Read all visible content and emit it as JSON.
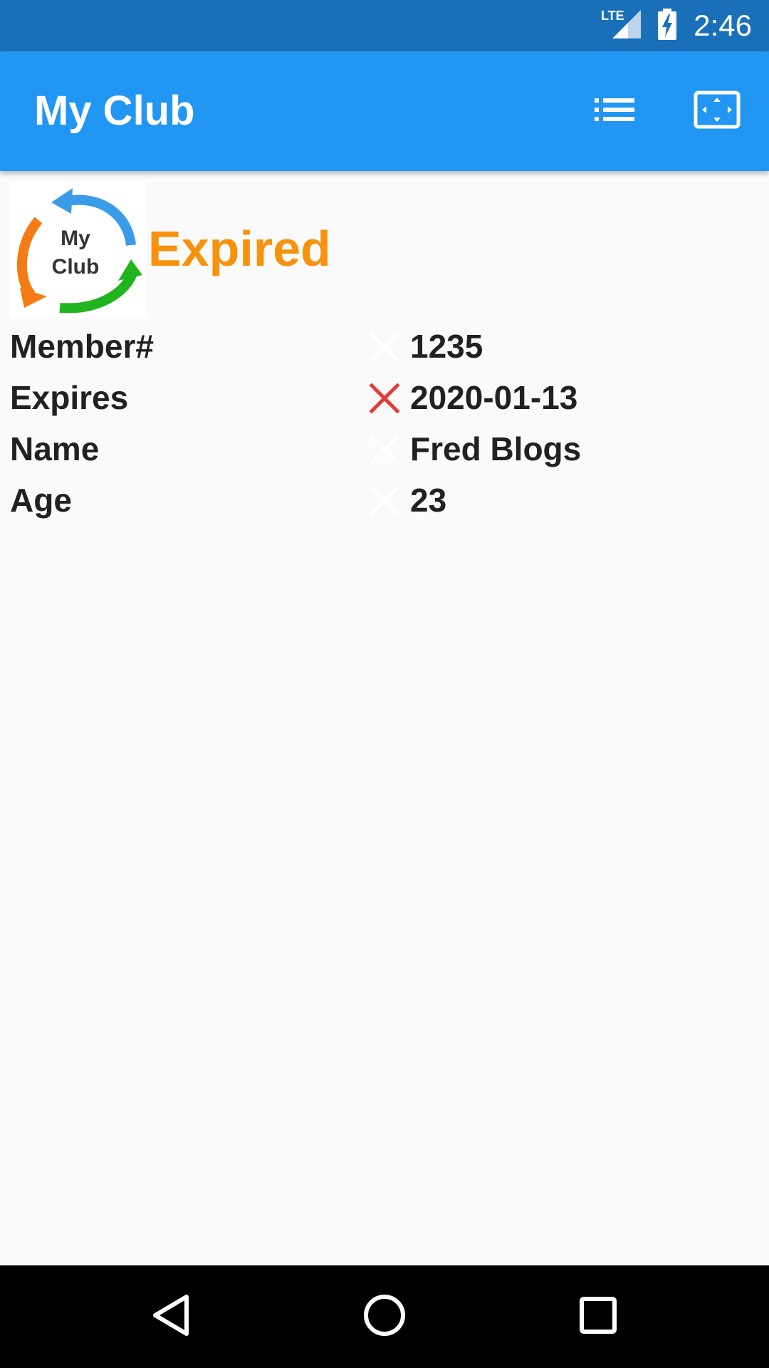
{
  "status_bar": {
    "time": "2:46",
    "network_label": "LTE",
    "icons": [
      "signal-icon",
      "battery-charging-icon"
    ]
  },
  "app_bar": {
    "title": "My Club",
    "actions": [
      {
        "name": "list-icon"
      },
      {
        "name": "fullscreen-icon"
      }
    ],
    "color": "#2196f3"
  },
  "membership": {
    "logo_text": [
      "My",
      "Club"
    ],
    "status": "Expired",
    "status_color": "#f7920c",
    "rows": [
      {
        "label": "Member#",
        "value": "1235",
        "invalid": false
      },
      {
        "label": "Expires",
        "value": "2020-01-13",
        "invalid": true
      },
      {
        "label": "Name",
        "value": "Fred Blogs",
        "invalid": false
      },
      {
        "label": "Age",
        "value": "23",
        "invalid": false
      }
    ],
    "invalid_icon_color": "#e53935"
  },
  "nav_bar": {
    "buttons": [
      "back-icon",
      "home-icon",
      "recents-icon"
    ]
  }
}
